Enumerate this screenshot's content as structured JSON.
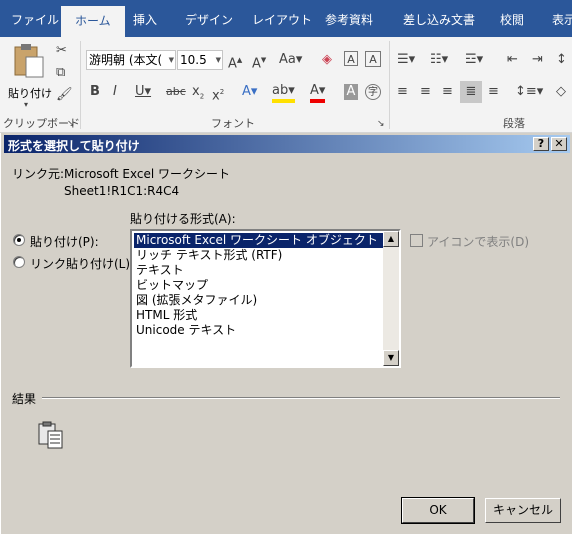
{
  "ribbon": {
    "tabs": [
      "ファイル",
      "ホーム",
      "挿入",
      "デザイン",
      "レイアウト",
      "参考資料",
      "差し込み文書",
      "校閲",
      "表示"
    ],
    "active_tab": "ホーム",
    "clipboard": {
      "paste_label": "貼り付け",
      "group_label": "クリップボード"
    },
    "font": {
      "font_name": "游明朝 (本文(",
      "font_size": "10.5",
      "group_label": "フォント"
    },
    "paragraph": {
      "group_label": "段落"
    }
  },
  "dialog": {
    "title": "形式を選択して貼り付け",
    "help_button": "?",
    "close_button": "✕",
    "link_source_label": "リンク元:",
    "link_source_value": "Microsoft Excel ワークシート",
    "link_range": "Sheet1!R1C1:R4C4",
    "format_label": "貼り付ける形式(A):",
    "paste_option": "貼り付け(P):",
    "paste_link_option": "リンク貼り付け(L):",
    "formats": [
      "Microsoft Excel ワークシート オブジェクト",
      "リッチ テキスト形式 (RTF)",
      "テキスト",
      "ビットマップ",
      "図 (拡張メタファイル)",
      "HTML 形式",
      "Unicode テキスト"
    ],
    "selected_format": "Microsoft Excel ワークシート オブジェクト",
    "display_as_icon": "アイコンで表示(D)",
    "result_label": "結果",
    "ok_button": "OK",
    "cancel_button": "キャンセル"
  }
}
